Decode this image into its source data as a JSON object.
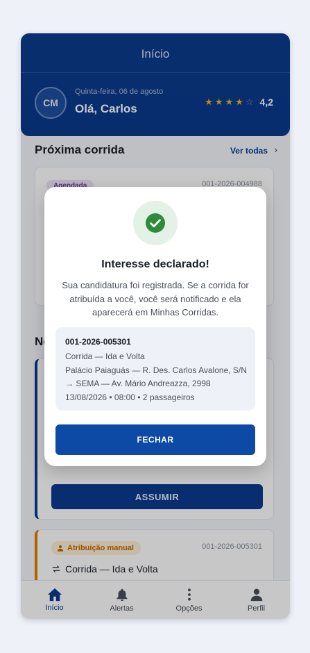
{
  "header": {
    "title": "Início",
    "avatar_initials": "CM",
    "date": "Quinta-feira, 06 de agosto",
    "greeting": "Olá, Carlos",
    "rating": {
      "value": 4.2,
      "value_label": "4,2",
      "stars_filled": 4,
      "stars_total": 5
    }
  },
  "next_ride": {
    "title": "Próxima corrida",
    "link_label": "Ver todas",
    "card": {
      "badge": "Agendada",
      "code": "001-2026-004988"
    }
  },
  "new_rides": {
    "title": "No",
    "card": {
      "button_label": "ASSUMIR"
    },
    "manual_card": {
      "badge": "Atribuição manual",
      "code": "001-2026-005301",
      "route": "Corrida — Ida e Volta"
    }
  },
  "bottom_nav": {
    "items": [
      {
        "label": "Início",
        "icon": "home-icon",
        "active": true
      },
      {
        "label": "Alertas",
        "icon": "bell-icon",
        "active": false
      },
      {
        "label": "Opções",
        "icon": "more-vert-icon",
        "active": false
      },
      {
        "label": "Perfil",
        "icon": "person-icon",
        "active": false
      }
    ]
  },
  "modal": {
    "title": "Interesse declarado!",
    "message": "Sua candidatura foi registrada. Se a corrida for atribuída a você, você será notificado e ela aparecerá em Minhas Corridas.",
    "details": {
      "code": "001-2026-005301",
      "type": "Corrida — Ida e Volta",
      "origin": "Palácio Paiaguás — R. Des. Carlos Avalone, S/N",
      "destination": "→ SEMA — Av. Mário Andreazza, 2998",
      "schedule": "13/08/2026 • 08:00 • 2 passageiros"
    },
    "close_label": "FECHAR"
  },
  "colors": {
    "primary": "#0b3b8f",
    "button_primary": "#0d4aa6",
    "success": "#2e8b3e",
    "warning": "#e07b00",
    "star": "#f3b619"
  }
}
